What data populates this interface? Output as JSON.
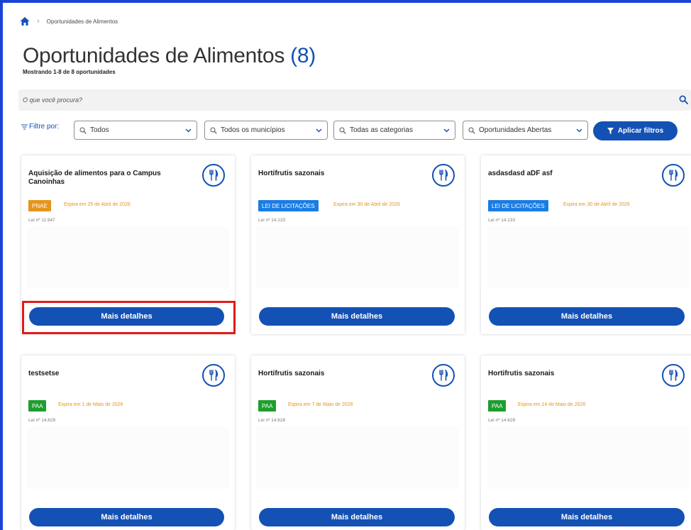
{
  "breadcrumb": {
    "current": "Oportunidades de Alimentos"
  },
  "page": {
    "title": "Oportunidades de Alimentos",
    "count": "(8)",
    "subtitle": "Mostrando 1-8 de 8 oportunidades"
  },
  "search": {
    "placeholder": "O que você procura?"
  },
  "filters": {
    "label": "Filtre por:",
    "selects": [
      {
        "value": "Todos"
      },
      {
        "value": "Todos os municípios"
      },
      {
        "value": "Todas as categorias"
      },
      {
        "value": "Oportunidades Abertas"
      }
    ],
    "apply_label": "Aplicar filtros"
  },
  "colors": {
    "primary": "#1451b4",
    "pnae": "#e5951d",
    "licitacoes": "#1a7de3",
    "paa": "#1e9e2d",
    "expire": "#e5951d",
    "highlight": "#e21b1b"
  },
  "cards": [
    {
      "title": "Aquisição de alimentos para o Campus Canoinhas",
      "badge": "PNAE",
      "expires": "Expira em 25 de Abril de 2026",
      "law": "Lei nº 11.947",
      "button": "Mais detalhes"
    },
    {
      "title": "Hortifrutis sazonais",
      "badge": "LEI DE LICITAÇÕES",
      "expires": "Expira em 30 de Abril de 2026",
      "law": "Lei nº 14.133",
      "button": "Mais detalhes"
    },
    {
      "title": "asdasdasd aDF asf",
      "badge": "LEI DE LICITAÇÕES",
      "expires": "Expira em 30 de Abril de 2026",
      "law": "Lei nº 14.133",
      "button": "Mais detalhes"
    },
    {
      "title": "testsetse",
      "badge": "PAA",
      "expires": "Expira em 1 de Maio de 2026",
      "law": "Lei nº 14.628",
      "button": "Mais detalhes"
    },
    {
      "title": "Hortifrutis sazonais",
      "badge": "PAA",
      "expires": "Expira em 7 de Maio de 2026",
      "law": "Lei nº 14.628",
      "button": "Mais detalhes"
    },
    {
      "title": "Hortifrutis sazonais",
      "badge": "PAA",
      "expires": "Expira em 14 de Maio de 2026",
      "law": "Lei nº 14.628",
      "button": "Mais detalhes"
    }
  ]
}
